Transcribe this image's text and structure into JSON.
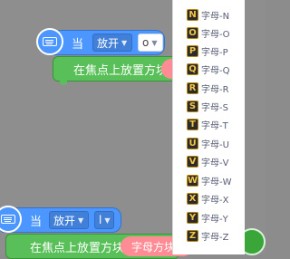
{
  "block1": {
    "when": "当",
    "action_dropdown": "放开",
    "key_dropdown": "o",
    "statement": "在焦点上放置方块"
  },
  "block2": {
    "when": "当",
    "action_dropdown": "放开",
    "key_dropdown": "l",
    "statement": "在焦点上放置方块",
    "pill": "字母方块"
  },
  "menu": {
    "items": [
      {
        "key": "N",
        "label": "字母-N"
      },
      {
        "key": "O",
        "label": "字母-O"
      },
      {
        "key": "P",
        "label": "字母-P"
      },
      {
        "key": "Q",
        "label": "字母-Q"
      },
      {
        "key": "R",
        "label": "字母-R"
      },
      {
        "key": "S",
        "label": "字母-S"
      },
      {
        "key": "T",
        "label": "字母-T"
      },
      {
        "key": "U",
        "label": "字母-U"
      },
      {
        "key": "V",
        "label": "字母-V"
      },
      {
        "key": "W",
        "label": "字母-W"
      },
      {
        "key": "X",
        "label": "字母-X"
      },
      {
        "key": "Y",
        "label": "字母-Y"
      },
      {
        "key": "Z",
        "label": "字母-Z"
      }
    ]
  },
  "colors": {
    "event": "#4c97ff",
    "action": "#59c059",
    "pill": "#ff8c94",
    "workspace": "#8e8e8e"
  }
}
